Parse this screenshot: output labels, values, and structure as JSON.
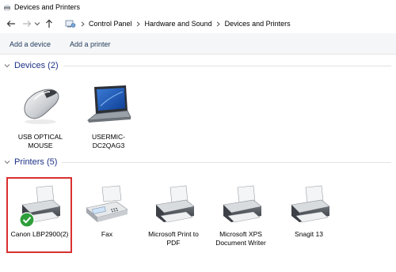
{
  "window": {
    "title": "Devices and Printers"
  },
  "address_bar": {
    "breadcrumbs": [
      "Control Panel",
      "Hardware and Sound",
      "Devices and Printers"
    ]
  },
  "commands": {
    "add_device": "Add a device",
    "add_printer": "Add a printer"
  },
  "groups": {
    "devices": {
      "title": "Devices (2)",
      "items": [
        {
          "label": "USB OPTICAL MOUSE",
          "icon": "mouse-icon"
        },
        {
          "label": "USERMIC-DC2QAG3",
          "icon": "laptop-icon"
        }
      ]
    },
    "printers": {
      "title": "Printers (5)",
      "items": [
        {
          "label": "Canon LBP2900(2)",
          "icon": "printer-icon",
          "default": true,
          "selected": true
        },
        {
          "label": "Fax",
          "icon": "fax-icon"
        },
        {
          "label": "Microsoft Print to PDF",
          "icon": "printer-icon"
        },
        {
          "label": "Microsoft XPS Document Writer",
          "icon": "printer-icon"
        },
        {
          "label": "Snagit 13",
          "icon": "printer-icon"
        }
      ]
    }
  },
  "colors": {
    "selection_border": "#d93030",
    "group_title": "#1e3287",
    "command_text": "#1e395b",
    "default_check": "#2e9e3a"
  }
}
